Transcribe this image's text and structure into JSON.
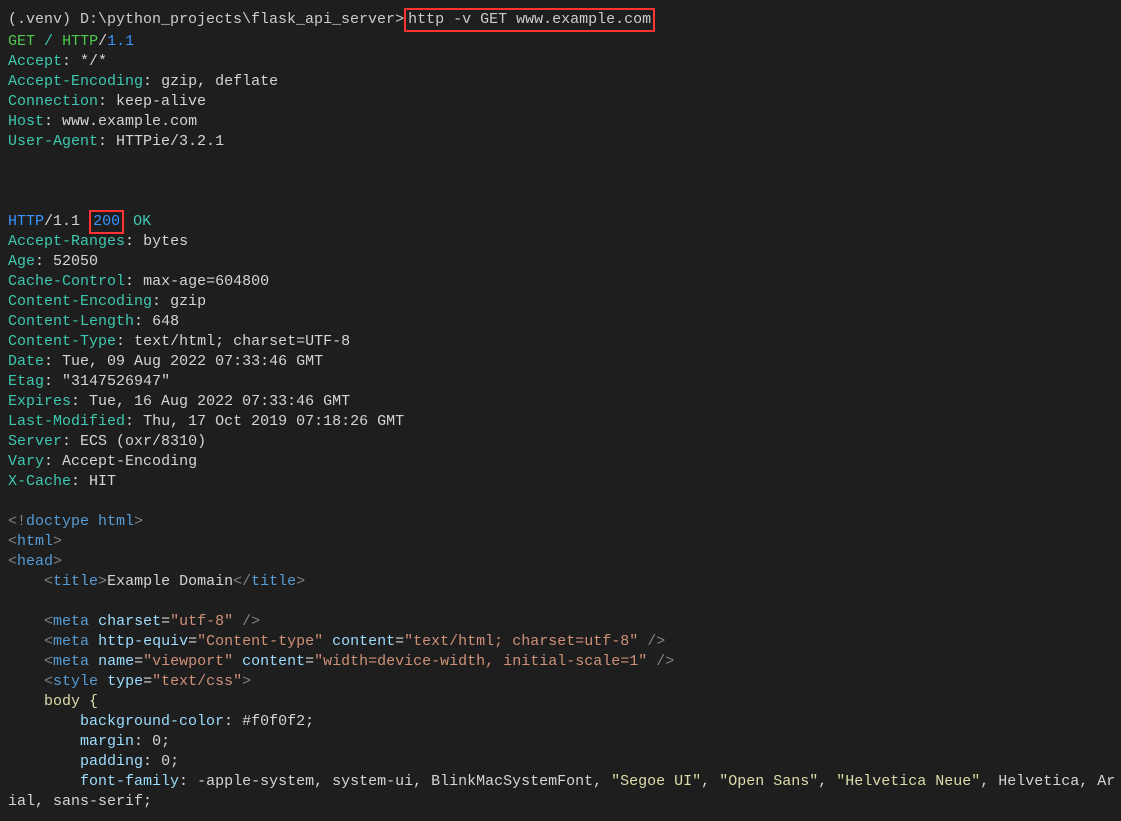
{
  "prompt": {
    "prefix": "(.venv) D:\\python_projects\\flask_api_server>",
    "command": "http -v GET www.example.com"
  },
  "request": {
    "method": "GET",
    "path": "/",
    "protocol": "HTTP",
    "version": "1.1",
    "headers": {
      "accept": {
        "key": "Accept",
        "value": "*/*"
      },
      "accept_encoding": {
        "key": "Accept-Encoding",
        "value": "gzip, deflate"
      },
      "connection": {
        "key": "Connection",
        "value": "keep-alive"
      },
      "host": {
        "key": "Host",
        "value": "www.example.com"
      },
      "user_agent": {
        "key": "User-Agent",
        "value": "HTTPie/3.2.1"
      }
    }
  },
  "response": {
    "protocol": "HTTP",
    "version": "1.1",
    "status_code": "200",
    "status_text": "OK",
    "headers": {
      "accept_ranges": {
        "key": "Accept-Ranges",
        "value": "bytes"
      },
      "age": {
        "key": "Age",
        "value": "52050"
      },
      "cache_control": {
        "key": "Cache-Control",
        "value": "max-age=604800"
      },
      "content_encoding": {
        "key": "Content-Encoding",
        "value": "gzip"
      },
      "content_length": {
        "key": "Content-Length",
        "value": "648"
      },
      "content_type": {
        "key": "Content-Type",
        "value": "text/html; charset=UTF-8"
      },
      "date": {
        "key": "Date",
        "value": "Tue, 09 Aug 2022 07:33:46 GMT"
      },
      "etag": {
        "key": "Etag",
        "value": "\"3147526947\""
      },
      "expires": {
        "key": "Expires",
        "value": "Tue, 16 Aug 2022 07:33:46 GMT"
      },
      "last_modified": {
        "key": "Last-Modified",
        "value": "Thu, 17 Oct 2019 07:18:26 GMT"
      },
      "server": {
        "key": "Server",
        "value": "ECS (oxr/8310)"
      },
      "vary": {
        "key": "Vary",
        "value": "Accept-Encoding"
      },
      "x_cache": {
        "key": "X-Cache",
        "value": "HIT"
      }
    }
  },
  "body": {
    "doctype": "doctype html",
    "html_open": "html",
    "head_open": "head",
    "title_tag": "title",
    "title_text": "Example Domain",
    "title_close": "title",
    "meta1_tag": "meta",
    "meta1_attr": "charset",
    "meta1_val": "\"utf-8\"",
    "meta2_tag": "meta",
    "meta2_attr1": "http-equiv",
    "meta2_val1": "\"Content-type\"",
    "meta2_attr2": "content",
    "meta2_val2": "\"text/html; charset=utf-8\"",
    "meta3_tag": "meta",
    "meta3_attr1": "name",
    "meta3_val1": "\"viewport\"",
    "meta3_attr2": "content",
    "meta3_val2": "\"width=device-width, initial-scale=1\"",
    "style_tag": "style",
    "style_attr": "type",
    "style_val": "\"text/css\"",
    "css_body": "    body {",
    "css_bg": {
      "prop": "background-color",
      "val": "#f0f0f2"
    },
    "css_margin": {
      "prop": "margin",
      "val": "0"
    },
    "css_padding": {
      "prop": "padding",
      "val": "0"
    },
    "css_font_prop": "font-family",
    "css_font_val_plain1": "-apple-system, system-ui, BlinkMacSystemFont, ",
    "css_font_str1": "\"Segoe UI\"",
    "css_font_str2": "\"Open Sans\"",
    "css_font_str3": "\"Helvetica Neue\"",
    "css_font_val_plain2": "Helvetica, Ar",
    "css_font_line2": "ial, sans-serif"
  },
  "symbols": {
    "lt": "<",
    "gt": ">",
    "slash": "/",
    "colon": ":",
    "space": " ",
    "exclaim": "!",
    "eq": "=",
    "comma_sp": ", ",
    "semi": ";"
  }
}
